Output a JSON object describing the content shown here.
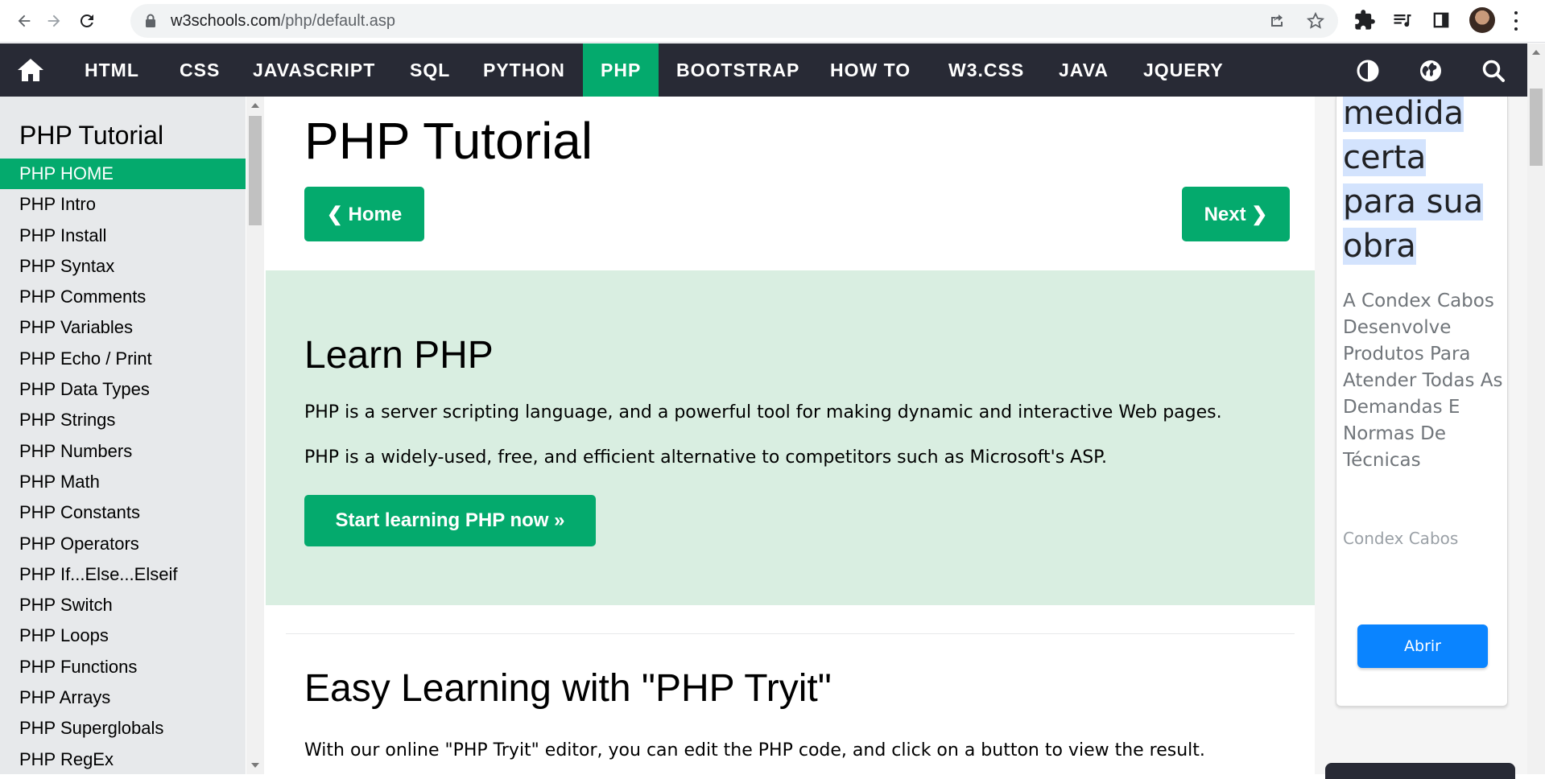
{
  "browser": {
    "url_host": "w3schools.com",
    "url_path": "/php/default.asp"
  },
  "topnav": {
    "items": [
      "HTML",
      "CSS",
      "JAVASCRIPT",
      "SQL",
      "PYTHON",
      "PHP",
      "BOOTSTRAP",
      "HOW TO",
      "W3.CSS",
      "JAVA",
      "JQUERY"
    ],
    "active": "PHP",
    "accent": "#04aa6d",
    "background": "#282a35"
  },
  "sidebar": {
    "title": "PHP Tutorial",
    "items": [
      "PHP HOME",
      "PHP Intro",
      "PHP Install",
      "PHP Syntax",
      "PHP Comments",
      "PHP Variables",
      "PHP Echo / Print",
      "PHP Data Types",
      "PHP Strings",
      "PHP Numbers",
      "PHP Math",
      "PHP Constants",
      "PHP Operators",
      "PHP If...Else...Elseif",
      "PHP Switch",
      "PHP Loops",
      "PHP Functions",
      "PHP Arrays",
      "PHP Superglobals",
      "PHP RegEx"
    ],
    "active_index": 0
  },
  "main": {
    "title": "PHP Tutorial",
    "prev_label": "❮ Home",
    "next_label": "Next ❯",
    "hero": {
      "heading": "Learn PHP",
      "p1": "PHP is a server scripting language, and a powerful tool for making dynamic and interactive Web pages.",
      "p2": "PHP is a widely-used, free, and efficient alternative to competitors such as Microsoft's ASP.",
      "cta": "Start learning PHP now »",
      "background": "#d9eee1"
    },
    "section2": {
      "heading": "Easy Learning with \"PHP Tryit\"",
      "text": "With our online \"PHP Tryit\" editor, you can edit the PHP code, and click on a button to view the result."
    }
  },
  "ad": {
    "headline": [
      "medida",
      "certa",
      "para sua",
      "obra"
    ],
    "body": "A Condex Cabos Desenvolve Produtos Para Atender Todas As Demandas E Normas De Técnicas",
    "brand": "Condex Cabos",
    "button": "Abrir",
    "button_color": "#0a84ff"
  },
  "icons": {
    "browser": [
      "back-arrow-icon",
      "forward-arrow-icon",
      "reload-icon",
      "lock-icon",
      "share-icon",
      "star-icon",
      "extensions-icon",
      "media-icon",
      "side-panel-icon",
      "profile-avatar",
      "menu-icon"
    ],
    "topnav": [
      "home-icon",
      "contrast-icon",
      "globe-icon",
      "search-icon"
    ]
  }
}
